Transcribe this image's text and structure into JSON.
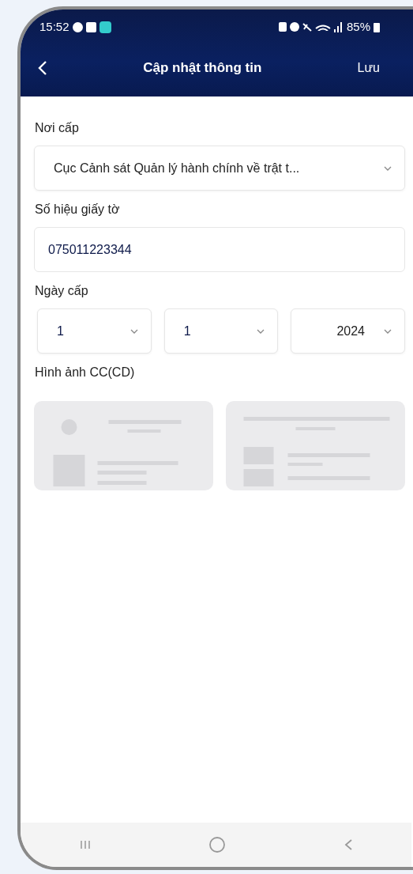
{
  "status_bar": {
    "time": "15:52",
    "battery": "85%"
  },
  "header": {
    "title": "Cập nhật thông tin",
    "action": "Lưu"
  },
  "fields": [
    {
      "kind": "select",
      "label": "Nơi cấp",
      "value": "Cục Cảnh sát Quản lý hành chính về trật t..."
    },
    {
      "kind": "input",
      "label": "Số hiệu giấy tờ",
      "value": "075011223344"
    },
    {
      "kind": "date",
      "label": "Ngày cấp",
      "parts": [
        "1",
        "1",
        "2024"
      ]
    },
    {
      "kind": "images",
      "label": "Hình ảnh CC(CD)"
    }
  ]
}
